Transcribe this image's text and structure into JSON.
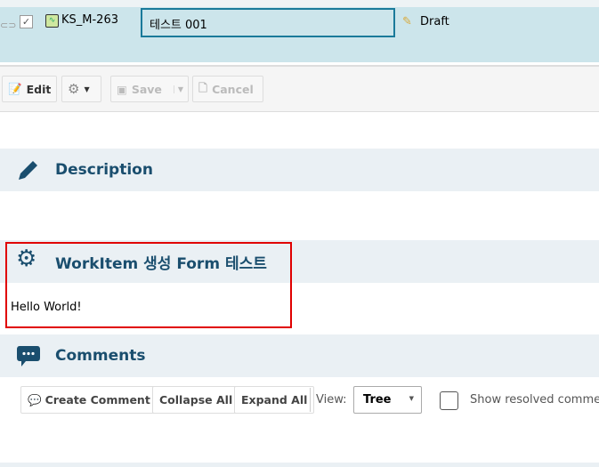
{
  "header": {
    "id": "KS_M-263",
    "title_value": "테스트 001",
    "status": "Draft"
  },
  "toolbar": {
    "edit": "Edit",
    "save": "Save",
    "cancel": "Cancel"
  },
  "sections": {
    "description": {
      "title": "Description"
    },
    "custom": {
      "title": "WorkItem 생성 Form 테스트",
      "content": "Hello World!"
    },
    "comments": {
      "title": "Comments",
      "create": "Create Comment",
      "collapse": "Collapse All",
      "expand": "Expand All",
      "view_label": "View:",
      "view_value": "Tree",
      "show_resolved": "Show resolved comments"
    }
  },
  "colors": {
    "row_bg": "#cce5eb",
    "section_bg": "#eaf0f4",
    "accent": "#1a4e6e",
    "highlight": "#e00000"
  }
}
